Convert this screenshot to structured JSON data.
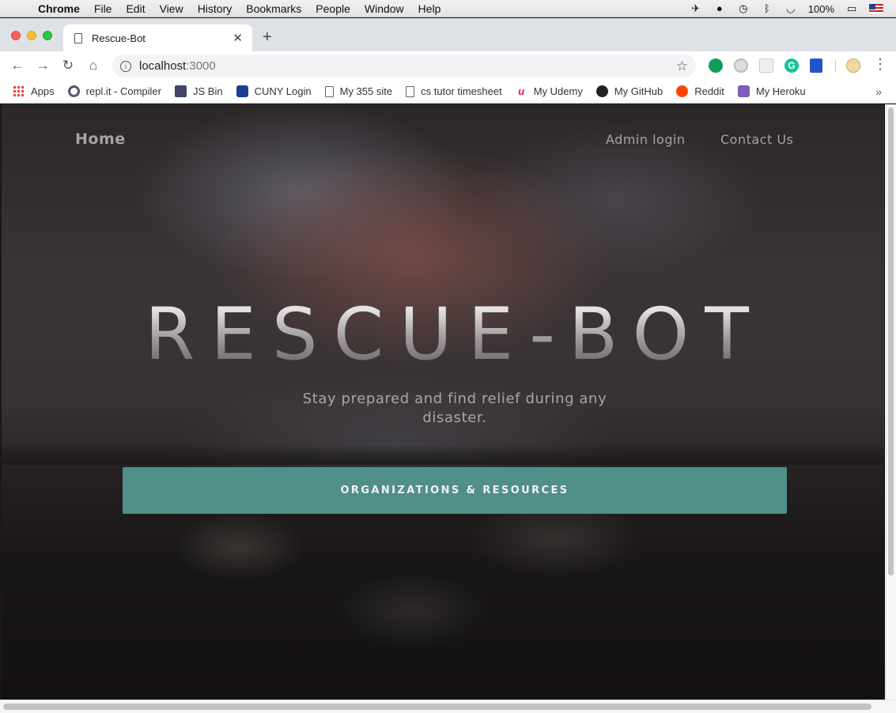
{
  "menubar": {
    "app": "Chrome",
    "items": [
      "File",
      "Edit",
      "View",
      "History",
      "Bookmarks",
      "People",
      "Window",
      "Help"
    ],
    "battery": "100%"
  },
  "tab": {
    "title": "Rescue-Bot"
  },
  "toolbar": {
    "url_host": "localhost",
    "url_port": ":3000"
  },
  "bookmarks": [
    {
      "label": "Apps",
      "icon": "apps-grid-icon"
    },
    {
      "label": "repl.it - Compiler",
      "icon": "repl-icon"
    },
    {
      "label": "JS Bin",
      "icon": "jsbin-icon"
    },
    {
      "label": "CUNY Login",
      "icon": "cuny-icon"
    },
    {
      "label": "My 355 site",
      "icon": "document-icon"
    },
    {
      "label": "cs tutor timesheet",
      "icon": "document-icon"
    },
    {
      "label": "My Udemy",
      "icon": "udemy-icon"
    },
    {
      "label": "My GitHub",
      "icon": "github-icon"
    },
    {
      "label": "Reddit",
      "icon": "reddit-icon"
    },
    {
      "label": "My Heroku",
      "icon": "heroku-icon"
    }
  ],
  "page": {
    "nav": {
      "home": "Home",
      "admin": "Admin login",
      "contact": "Contact Us"
    },
    "hero": {
      "title": "RESCUE-BOT",
      "subtitle": "Stay prepared and find relief during any disaster.",
      "cta": "ORGANIZATIONS & RESOURCES"
    },
    "colors": {
      "cta": "#518f8a",
      "nav_text": "#a8a2a2"
    }
  }
}
